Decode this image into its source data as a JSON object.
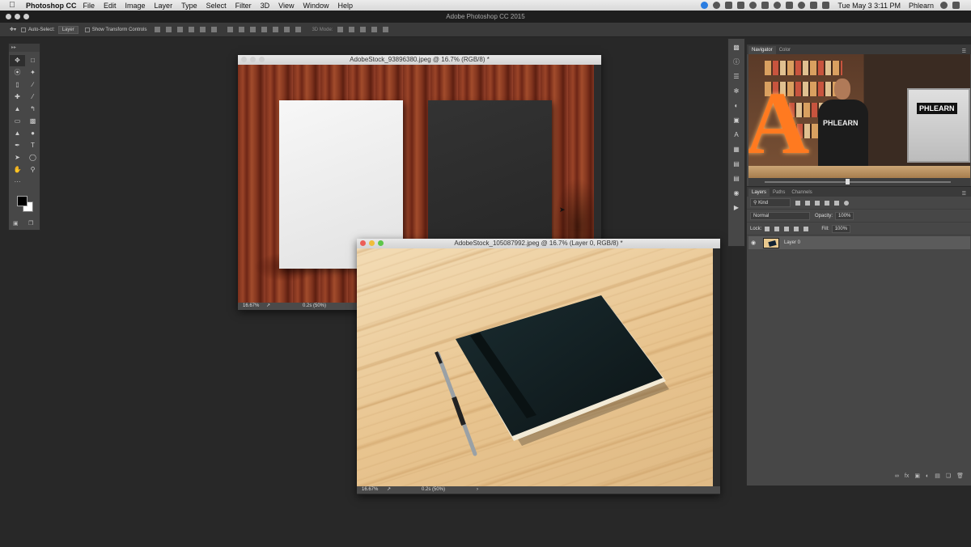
{
  "menubar": {
    "app_name": "Photoshop CC",
    "items": [
      "File",
      "Edit",
      "Image",
      "Layer",
      "Type",
      "Select",
      "Filter",
      "3D",
      "View",
      "Window",
      "Help"
    ],
    "clock": "Tue May 3  3:11 PM",
    "user": "Phlearn"
  },
  "app_title": "Adobe Photoshop CC 2015",
  "options_bar": {
    "auto_select_label": "Auto-Select:",
    "auto_select_value": "Layer",
    "transform_controls_label": "Show Transform Controls",
    "mode_3d_label": "3D Mode:"
  },
  "tools": {
    "icons": [
      "move-icon",
      "marquee-icon",
      "lasso-icon",
      "magic-wand-icon",
      "crop-icon",
      "eyedropper-icon",
      "healing-brush-icon",
      "brush-icon",
      "clone-stamp-icon",
      "history-brush-icon",
      "eraser-icon",
      "gradient-icon",
      "blur-icon",
      "dodge-icon",
      "pen-icon",
      "type-icon",
      "path-selection-icon",
      "ellipse-icon",
      "hand-icon",
      "zoom-icon"
    ],
    "foreground_color": "#000000",
    "background_color": "#ffffff"
  },
  "doc1": {
    "title": "AdobeStock_93896380.jpeg @ 16.7% (RGB/8) *",
    "zoom": "16.67%",
    "timing": "0.2s (50%)"
  },
  "doc2": {
    "title": "AdobeStock_105087992.jpeg @ 16.7% (Layer 0, RGB/8) *",
    "zoom": "16.67%",
    "timing": "0.2s (50%)"
  },
  "navigator": {
    "tabs": [
      "Navigator",
      "Color"
    ],
    "thumbnail_text_shirt": "PHLEARN",
    "thumbnail_text_monitor": "PHLEARN"
  },
  "layers": {
    "tabs": [
      "Layers",
      "Paths",
      "Channels"
    ],
    "filter_kind": "Kind",
    "blend_mode": "Normal",
    "opacity_label": "Opacity:",
    "opacity_value": "100%",
    "lock_label": "Lock:",
    "fill_label": "Fill:",
    "fill_value": "100%",
    "items": [
      {
        "name": "Layer 0",
        "visible": true
      }
    ],
    "footer_fx": "fx"
  }
}
